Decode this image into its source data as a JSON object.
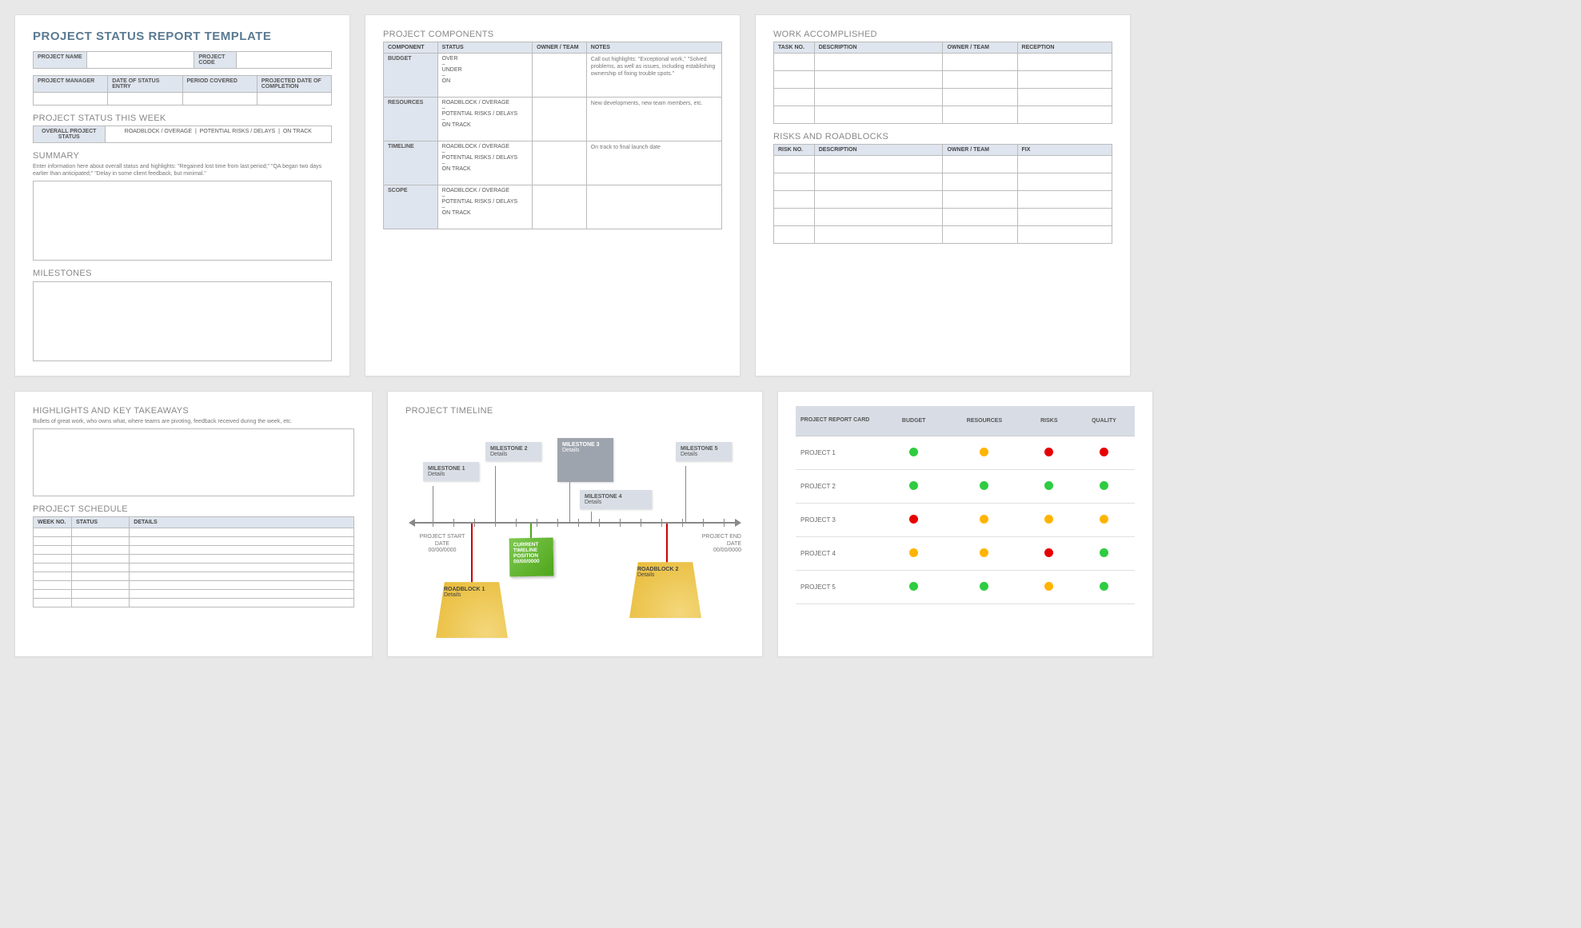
{
  "page1": {
    "title": "PROJECT STATUS REPORT TEMPLATE",
    "meta1": {
      "projname": "PROJECT NAME",
      "projcode": "PROJECT CODE"
    },
    "meta2": {
      "pm": "PROJECT MANAGER",
      "dse": "DATE OF STATUS ENTRY",
      "period": "PERIOD COVERED",
      "pdc": "PROJECTED DATE OF COMPLETION"
    },
    "status_week": "PROJECT STATUS THIS WEEK",
    "status_row": {
      "ops": "OVERALL PROJECT STATUS",
      "ro": "ROADBLOCK / OVERAGE",
      "pr": "POTENTIAL RISKS / DELAYS",
      "ot": "ON TRACK"
    },
    "summary": "SUMMARY",
    "summary_hint": "Enter information here about overall status and highlights: \"Regained lost time from last period;\" \"QA began two days earlier than anticipated;\" \"Delay in some client feedback, but minimal.\"",
    "milestones": "MILESTONES"
  },
  "page2": {
    "title": "PROJECT COMPONENTS",
    "headers": {
      "c": "COMPONENT",
      "s": "STATUS",
      "ot": "OWNER / TEAM",
      "n": "NOTES"
    },
    "rows": [
      {
        "c": "BUDGET",
        "s": "OVER\n–\nUNDER\n–\nON",
        "n": "Call out highlights: \"Exceptional work,\" \"Solved problems, as well as issues, including establishing ownership of fixing trouble spots.\""
      },
      {
        "c": "RESOURCES",
        "s": "ROADBLOCK / OVERAGE\n–\nPOTENTIAL RISKS / DELAYS\n–\nON TRACK",
        "n": "New developments, new team members, etc."
      },
      {
        "c": "TIMELINE",
        "s": "ROADBLOCK / OVERAGE\n–\nPOTENTIAL RISKS / DELAYS\n–\nON TRACK",
        "n": "On track to final launch date"
      },
      {
        "c": "SCOPE",
        "s": "ROADBLOCK / OVERAGE\n–\nPOTENTIAL RISKS / DELAYS\n–\nON TRACK",
        "n": ""
      }
    ]
  },
  "page3": {
    "wa": "WORK ACCOMPLISHED",
    "wa_h": {
      "t": "TASK NO.",
      "d": "DESCRIPTION",
      "o": "OWNER / TEAM",
      "r": "RECEPTION"
    },
    "rr": "RISKS AND ROADBLOCKS",
    "rr_h": {
      "t": "RISK NO.",
      "d": "DESCRIPTION",
      "o": "OWNER / TEAM",
      "f": "FIX"
    }
  },
  "page4": {
    "hk": "HIGHLIGHTS AND KEY TAKEAWAYS",
    "hk_hint": "Bullets of great work, who owns what, where teams are pivoting, feedback received during the week, etc.",
    "ps": "PROJECT SCHEDULE",
    "ps_h": {
      "w": "WEEK NO.",
      "s": "STATUS",
      "d": "DETAILS"
    }
  },
  "page5": {
    "title": "PROJECT TIMELINE",
    "miles": [
      {
        "t": "MILESTONE 1",
        "d": "Details"
      },
      {
        "t": "MILESTONE 2",
        "d": "Details"
      },
      {
        "t": "MILESTONE 3",
        "d": "Details"
      },
      {
        "t": "MILESTONE 4",
        "d": "Details"
      },
      {
        "t": "MILESTONE 5",
        "d": "Details"
      }
    ],
    "start": {
      "l": "PROJECT START DATE",
      "d": "00/00/0000"
    },
    "end": {
      "l": "PROJECT END DATE",
      "d": "00/00/0000"
    },
    "cur": {
      "l1": "CURRENT",
      "l2": "TIMELINE",
      "l3": "POSITION",
      "d": "00/00/0000"
    },
    "roads": [
      {
        "t": "ROADBLOCK 1",
        "d": "Details"
      },
      {
        "t": "ROADBLOCK 2",
        "d": "Details"
      }
    ]
  },
  "page6": {
    "h": {
      "rc": "PROJECT REPORT CARD",
      "b": "BUDGET",
      "res": "RESOURCES",
      "risk": "RISKS",
      "q": "QUALITY"
    },
    "rows": [
      {
        "p": "PROJECT 1",
        "b": "g",
        "res": "y",
        "risk": "r",
        "q": "r"
      },
      {
        "p": "PROJECT 2",
        "b": "g",
        "res": "g",
        "risk": "g",
        "q": "g"
      },
      {
        "p": "PROJECT 3",
        "b": "r",
        "res": "y",
        "risk": "y",
        "q": "y"
      },
      {
        "p": "PROJECT 4",
        "b": "y",
        "res": "y",
        "risk": "r",
        "q": "g"
      },
      {
        "p": "PROJECT 5",
        "b": "g",
        "res": "g",
        "risk": "y",
        "q": "g"
      }
    ]
  }
}
